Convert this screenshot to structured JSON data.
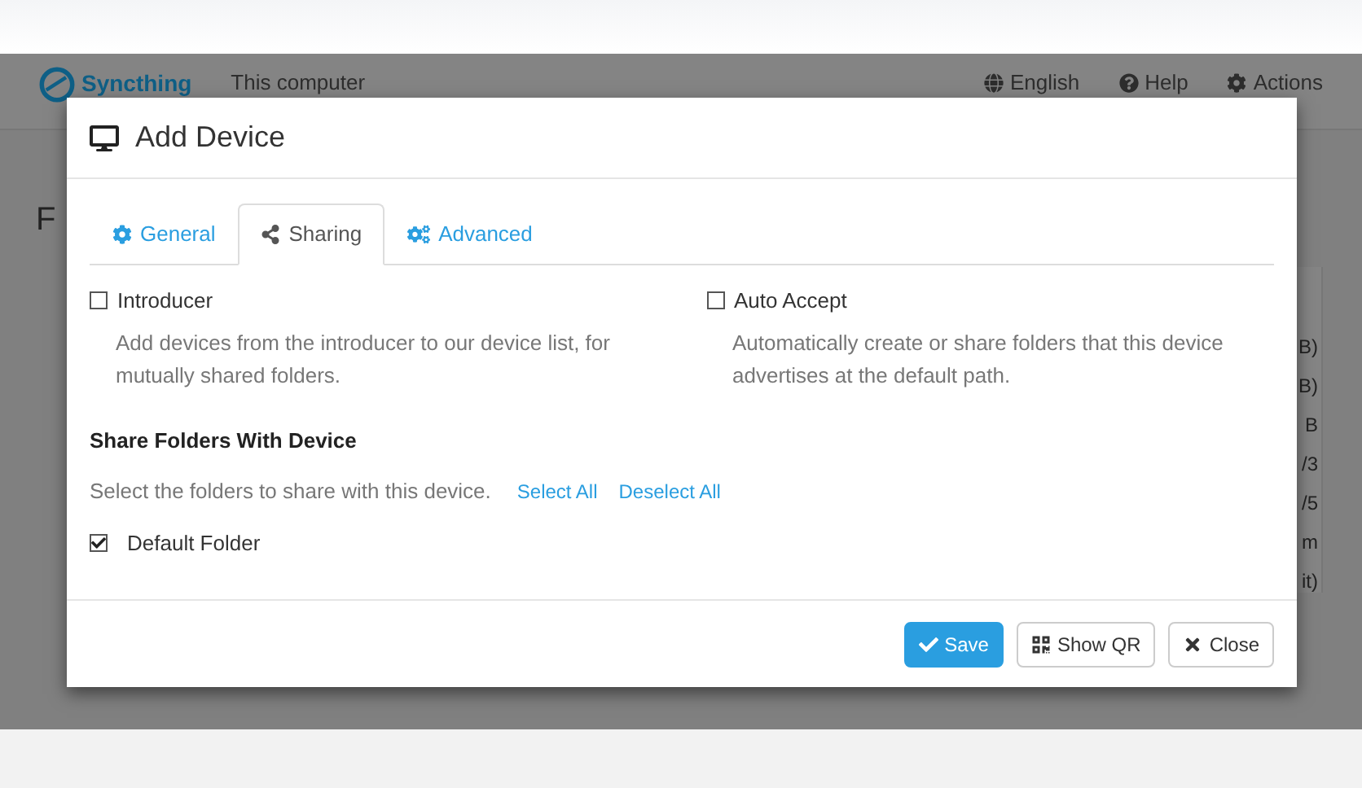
{
  "navbar": {
    "brand": "Syncthing",
    "device_name": "This computer",
    "items": [
      {
        "kind": "language",
        "label": "English"
      },
      {
        "kind": "help",
        "label": "Help"
      },
      {
        "kind": "actions",
        "label": "Actions"
      }
    ]
  },
  "page_heading": "F",
  "side_fragments": [
    "B)",
    "B)",
    "B",
    "/3",
    "/5",
    "m",
    "it)"
  ],
  "dialog": {
    "title": "Add Device",
    "tabs": [
      {
        "kind": "general",
        "label": "General",
        "selected": false
      },
      {
        "kind": "sharing",
        "label": "Sharing",
        "selected": true
      },
      {
        "kind": "advanced",
        "label": "Advanced",
        "selected": false
      }
    ],
    "options": [
      {
        "label": "Introducer",
        "checked": false,
        "help": "Add devices from the introducer to our device list, for mutually shared folders."
      },
      {
        "label": "Auto Accept",
        "checked": false,
        "help": "Automatically create or share folders that this device advertises at the default path."
      }
    ],
    "share_heading": "Share Folders With Device",
    "share_hint": "Select the folders to share with this device.",
    "select_all": "Select All",
    "deselect_all": "Deselect All",
    "folders": [
      {
        "label": "Default Folder",
        "checked": true
      }
    ],
    "buttons": [
      {
        "kind": "save",
        "label": "Save"
      },
      {
        "kind": "qr",
        "label": "Show QR"
      },
      {
        "kind": "close",
        "label": "Close"
      }
    ]
  }
}
